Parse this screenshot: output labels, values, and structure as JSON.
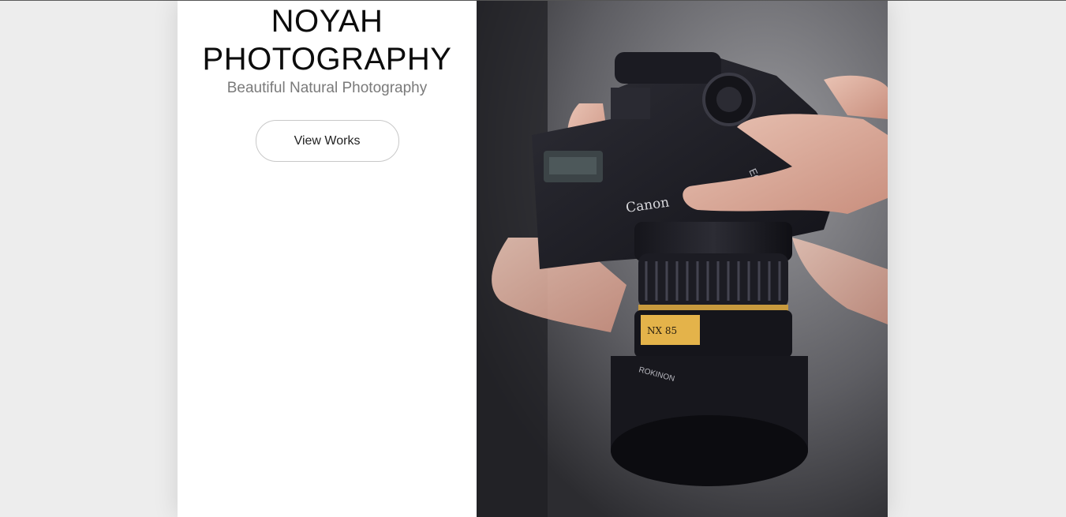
{
  "brand": {
    "title_line1": "NOYAH",
    "title_line2": "PHOTOGRAPHY",
    "tagline": "Beautiful Natural Photography"
  },
  "actions": {
    "view_works_label": "View Works"
  },
  "hero": {
    "camera_brand": "Canon",
    "camera_model": "EOS 5D",
    "lens_brand": "ROKINON",
    "lens_label": "NX 85"
  },
  "colors": {
    "background": "#ededed",
    "panel": "#ffffff",
    "title": "#0c0c0c",
    "tagline": "#7a7a7a",
    "button_border": "#c8c8c8"
  }
}
